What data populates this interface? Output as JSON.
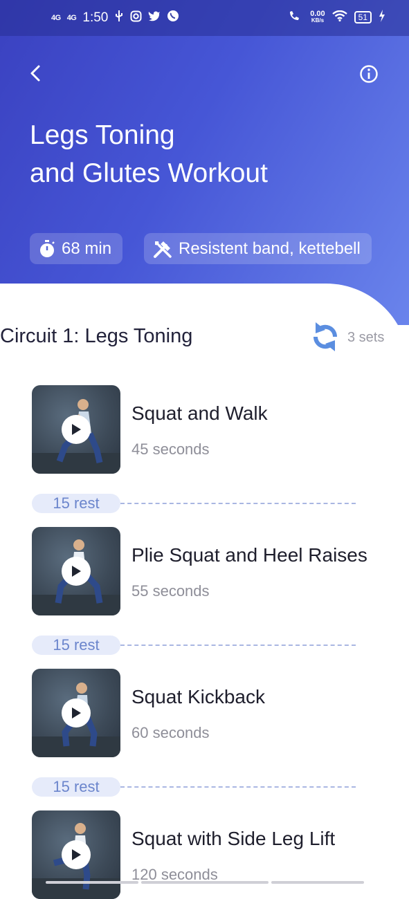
{
  "status_bar": {
    "signal1": "4G",
    "signal2": "4G",
    "time": "1:50",
    "net_speed": "0.00",
    "net_unit": "KB/s",
    "battery": "51",
    "icons": [
      "usb-icon",
      "instagram-icon",
      "twitter-icon",
      "whatsapp-icon",
      "volte-call-icon",
      "wifi-icon",
      "battery-icon",
      "charging-icon"
    ]
  },
  "header": {
    "back_icon": "chevron-left-icon",
    "info_icon": "info-icon",
    "title_line1": "Legs Toning",
    "title_line2": "and Glutes Workout",
    "duration": "68 min",
    "equipment": "Resistent band, kettebell"
  },
  "circuit": {
    "title": "Circuit 1: Legs Toning",
    "sets": "3 sets"
  },
  "exercises": [
    {
      "name": "Squat and Walk",
      "duration": "45 seconds",
      "rest": "15 rest"
    },
    {
      "name": "Plie Squat and Heel Raises",
      "duration": "55 seconds",
      "rest": "15 rest"
    },
    {
      "name": "Squat Kickback",
      "duration": "60 seconds",
      "rest": "15 rest"
    },
    {
      "name": "Squat with Side Leg Lift",
      "duration": "120 seconds"
    }
  ],
  "colors": {
    "header_start": "#3a41c0",
    "header_end": "#6a84ec",
    "accent": "#5b7fdc",
    "rest_bg": "#e6ebfa"
  }
}
